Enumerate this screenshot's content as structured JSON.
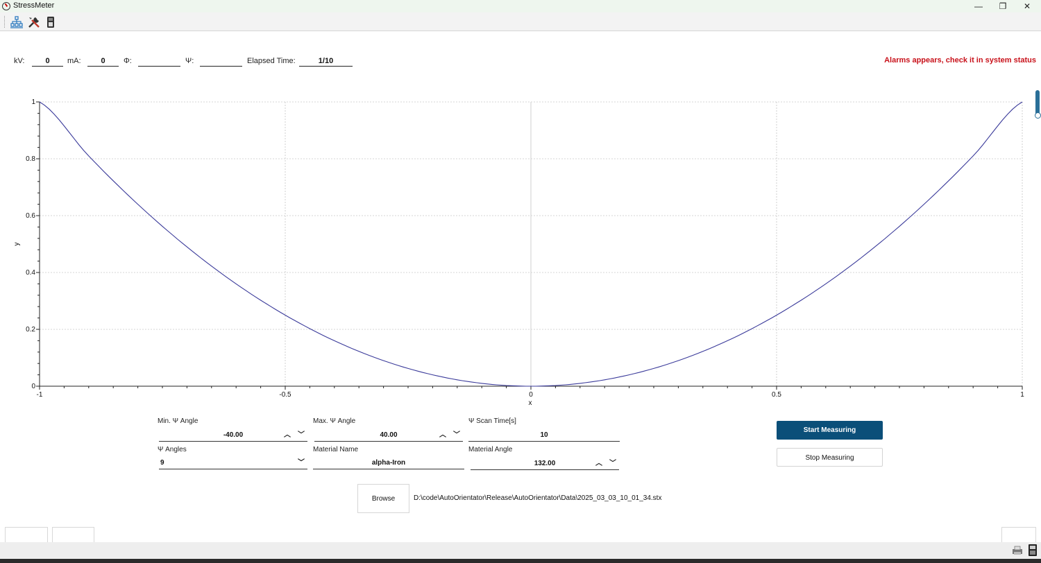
{
  "window": {
    "title": "StressMeter",
    "minimize": "—",
    "maximize": "❐",
    "close": "✕"
  },
  "toolbar": {
    "icons": [
      "network-icon",
      "tools-icon",
      "device-icon"
    ]
  },
  "status": {
    "kv_label": "kV:",
    "kv_value": "0",
    "ma_label": "mA:",
    "ma_value": "0",
    "phi_label": "Φ:",
    "phi_value": "",
    "psi_label": "Ψ:",
    "psi_value": "",
    "elapsed_label": "Elapsed Time:",
    "elapsed_value": "1/10",
    "alarm": "Alarms appears, check it in system status",
    "alarm_color": "#c8111a"
  },
  "chart_data": {
    "type": "line",
    "xlabel": "x",
    "ylabel": "y",
    "xlim": [
      -1,
      1
    ],
    "ylim": [
      0,
      1
    ],
    "xticks": [
      "-1",
      "-0.5",
      "0",
      "0.5",
      "1"
    ],
    "yticks": [
      "0",
      "0.2",
      "0.4",
      "0.6",
      "0.8",
      "1"
    ],
    "grid": true,
    "line_color": "#3a3a9a",
    "x": [
      -1,
      -0.9,
      -0.8,
      -0.7,
      -0.6,
      -0.5,
      -0.4,
      -0.3,
      -0.2,
      -0.1,
      0,
      0.1,
      0.2,
      0.3,
      0.4,
      0.5,
      0.6,
      0.7,
      0.8,
      0.9,
      1
    ],
    "y": [
      1,
      0.81,
      0.64,
      0.49,
      0.36,
      0.25,
      0.16,
      0.09,
      0.04,
      0.01,
      0,
      0.01,
      0.04,
      0.09,
      0.16,
      0.25,
      0.36,
      0.49,
      0.64,
      0.81,
      1
    ]
  },
  "form": {
    "min_psi": {
      "label": "Min. Ψ Angle",
      "value": "-40.00"
    },
    "max_psi": {
      "label": "Max. Ψ Angle",
      "value": "40.00"
    },
    "scan_time": {
      "label": "Ψ Scan Time[s]",
      "value": "10"
    },
    "psi_angles": {
      "label": "Ψ Angles",
      "value": "9"
    },
    "material_name": {
      "label": "Material Name",
      "value": "alpha-Iron"
    },
    "material_angle": {
      "label": "Material Angle",
      "value": "132.00"
    },
    "up_arrow": "︿",
    "down_arrow": "﹀",
    "combo_arrow": "﹀"
  },
  "actions": {
    "start": "Start Measuring",
    "stop": "Stop Measuring",
    "browse": "Browse"
  },
  "file_path": "D:\\code\\AutoOrientator\\Release\\AutoOrientator\\Data\\2025_03_03_10_01_34.stx",
  "colors": {
    "primary_button": "#0b4f79",
    "scroll_accent": "#2a6f98"
  }
}
